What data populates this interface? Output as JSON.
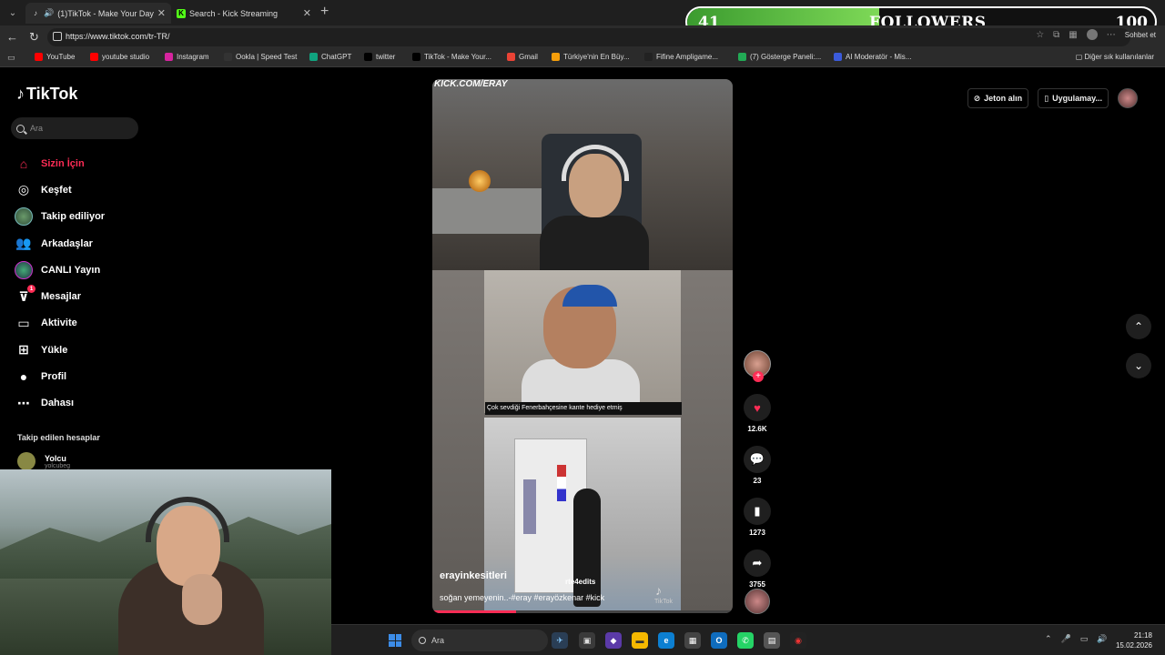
{
  "browser": {
    "tabs": [
      {
        "title": "(1)TikTok - Make Your Day",
        "active": true
      },
      {
        "title": "Search - Kick Streaming",
        "active": false
      }
    ],
    "url": "https://www.tiktok.com/tr-TR/",
    "bookmarks": [
      {
        "label": "YouTube",
        "color": "#ff0000"
      },
      {
        "label": "youtube studio",
        "color": "#ff0000"
      },
      {
        "label": "Instagram",
        "color": "#d6249f"
      },
      {
        "label": "Ookla | Speed Test",
        "color": "#333333"
      },
      {
        "label": "ChatGPT",
        "color": "#10a37f"
      },
      {
        "label": "twitter",
        "color": "#000000"
      },
      {
        "label": "TikTok - Make Your...",
        "color": "#000000"
      },
      {
        "label": "Gmail",
        "color": "#ea4335"
      },
      {
        "label": "Türkiye'nin En Büy...",
        "color": "#f59e0b"
      },
      {
        "label": "Fifine Ampligame...",
        "color": "#222222"
      },
      {
        "label": "(7) Gösterge Paneli:...",
        "color": "#22aa55"
      },
      {
        "label": "AI Moderatör - Mis...",
        "color": "#3b5bdb"
      }
    ],
    "bookmarks_folder": "Diğer sık kullanılanlar",
    "copilot_label": "Sohbet et"
  },
  "followers_goal": {
    "current": "41",
    "label": "FOLLOWERS",
    "goal": "100",
    "progress": 0.41
  },
  "tiktok": {
    "brand": "TikTok",
    "search_placeholder": "Ara",
    "nav": [
      {
        "label": "Sizin İçin",
        "icon": "home-icon",
        "active": true
      },
      {
        "label": "Keşfet",
        "icon": "compass-icon"
      },
      {
        "label": "Takip ediliyor",
        "icon": "following-avatar-icon"
      },
      {
        "label": "Arkadaşlar",
        "icon": "friends-icon"
      },
      {
        "label": "CANLI Yayın",
        "icon": "live-icon"
      },
      {
        "label": "Mesajlar",
        "icon": "messages-icon",
        "badge": "1"
      },
      {
        "label": "Aktivite",
        "icon": "activity-icon"
      },
      {
        "label": "Yükle",
        "icon": "upload-icon"
      },
      {
        "label": "Profil",
        "icon": "profile-icon"
      },
      {
        "label": "Dahası",
        "icon": "more-icon"
      }
    ],
    "following_title": "Takip edilen hesaplar",
    "following_account": {
      "name": "Yolcu",
      "handle": "yolcubeg"
    },
    "top_right": {
      "coins": "Jeton alın",
      "app": "Uygulamay..."
    },
    "video": {
      "watermark": "KICK.COM/ERAY",
      "caption_overlay": "Çok sevdiği Fenerbahçesine kante hediye etmiş",
      "inner_watermark": "rte4edits",
      "author": "erayinkesitleri",
      "description": "soğan yemeyenin..-#eray #erayözkenar #kick",
      "tiktok_mark": "TikTok",
      "progress": 0.28
    },
    "actions": {
      "likes": "12.6K",
      "comments": "23",
      "saves": "1273",
      "shares": "3755"
    }
  },
  "taskbar": {
    "search": "Ara",
    "time": "21:18",
    "date": "15.02.2026"
  }
}
